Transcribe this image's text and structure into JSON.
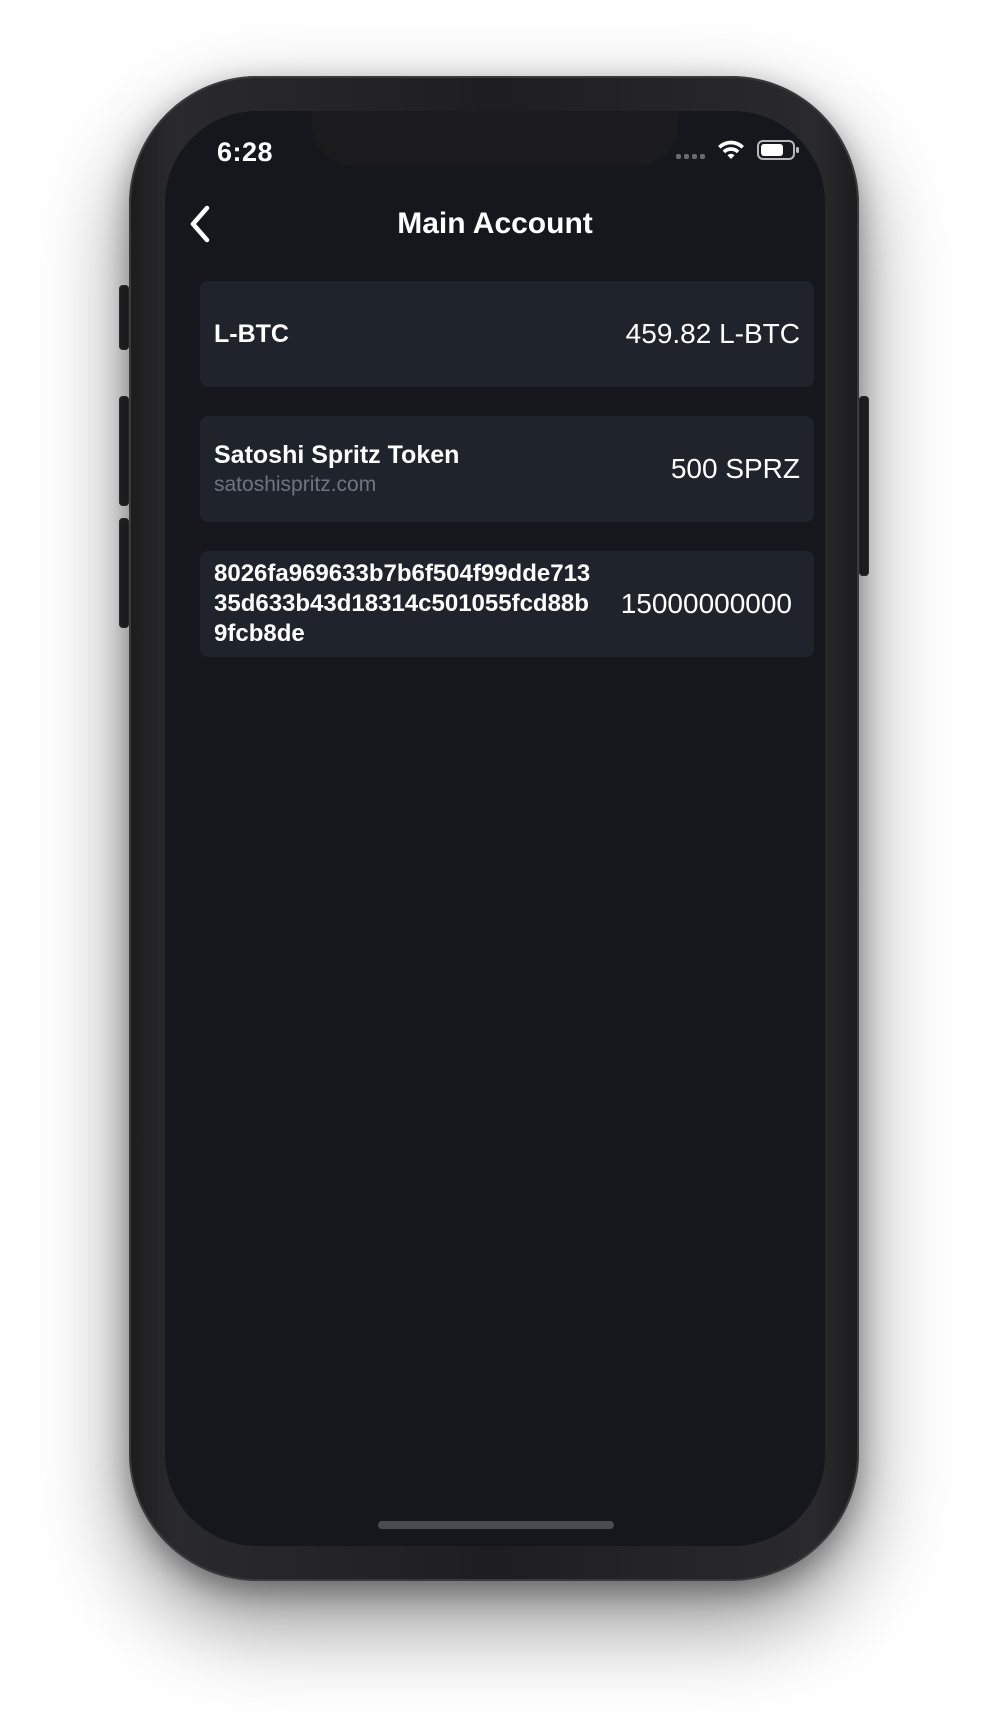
{
  "status_bar": {
    "time": "6:28",
    "icons": [
      "signal-icon",
      "wifi-icon",
      "battery-icon"
    ]
  },
  "nav": {
    "title": "Main Account",
    "back_icon": "chevron-left-icon"
  },
  "assets": [
    {
      "name": "L-BTC",
      "domain": "",
      "amount": "459.82 L-BTC"
    },
    {
      "name": "Satoshi Spritz Token",
      "domain": "satoshispritz.com",
      "amount": "500 SPRZ"
    },
    {
      "name": "8026fa969633b7b6f504f99dde71335d633b43d18314c501055fcd88b9fcb8de",
      "domain": "",
      "amount": "15000000000"
    }
  ],
  "colors": {
    "background": "#15171d",
    "card": "#1f232c",
    "text": "#ffffff",
    "secondary_text": "#6f7480"
  }
}
